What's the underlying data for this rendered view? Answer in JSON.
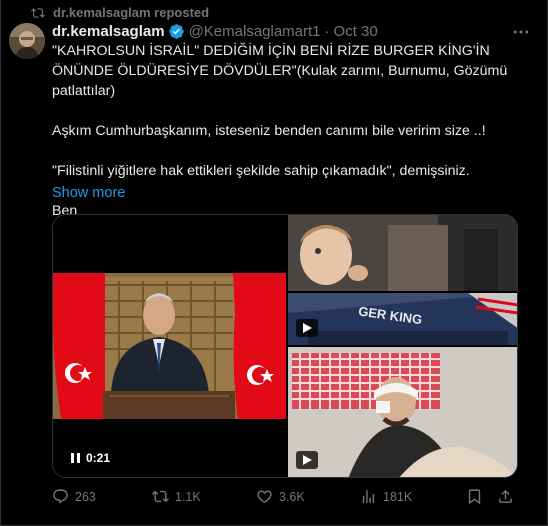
{
  "repost": {
    "label": "dr.kemalsaglam reposted",
    "icon": "repost-icon"
  },
  "author": {
    "name": "dr.kemalsaglam",
    "handle": "@Kemalsaglamart1",
    "separator": "·",
    "date": "Oct 30",
    "verified_color": "#1d9bf0"
  },
  "tweet": {
    "paragraphs": [
      "\"KAHROLSUN İSRAİL\" DEDİĞİM İÇİN BENİ RİZE BURGER KİNG'İN ÖNÜNDE ÖLDÜRESİYE DÖVDÜLER\"(Kulak zarımı, Burnumu, Gözümü patlattılar)",
      "Aşkım Cumhurbaşkanım, isteseniz benden canımı bile veririm size ..!",
      "\"Filistinli yiğitlere hak ettikleri şekilde sahip çıkamadık\", demişsiniz.",
      "Ben"
    ],
    "show_more": "Show more"
  },
  "media": {
    "video_time": "0:21",
    "storefront_sign": "GER KING"
  },
  "actions": {
    "replies": "263",
    "reposts": "1.1K",
    "likes": "3.6K",
    "views": "181K"
  },
  "colors": {
    "accent": "#1d9bf0",
    "muted": "#71767b",
    "text": "#e7e9ea",
    "background": "#000000",
    "flag_red": "#e30a17"
  }
}
